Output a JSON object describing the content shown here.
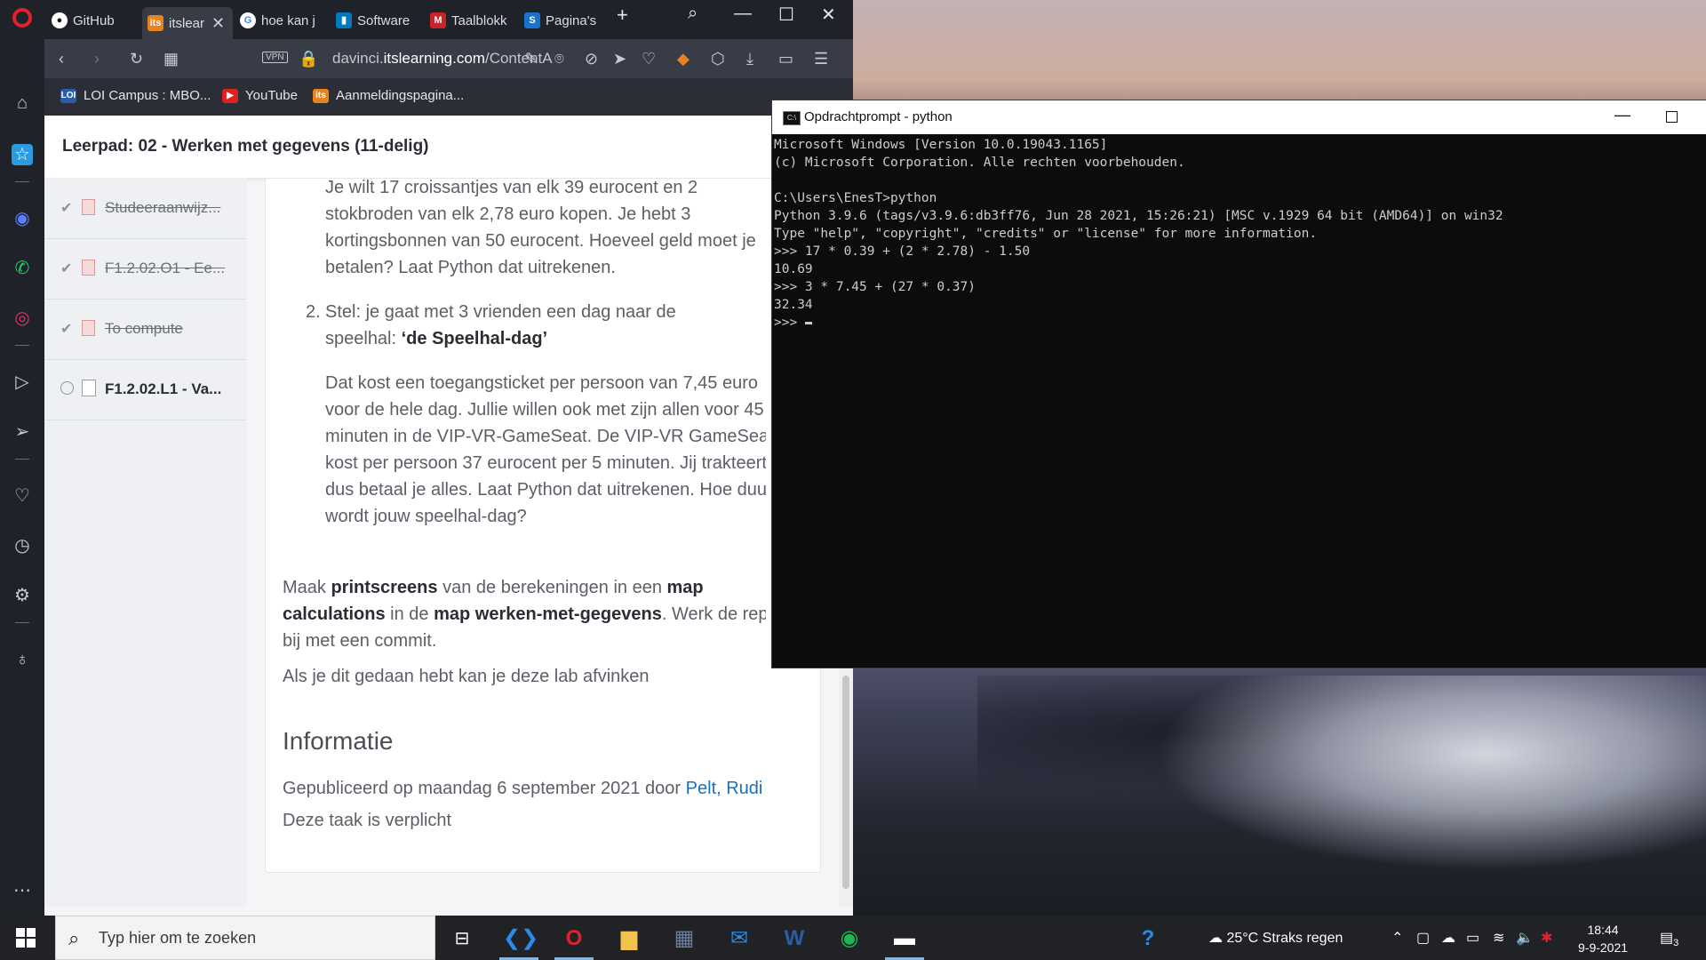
{
  "browser": {
    "tabs": [
      {
        "label": "GitHub",
        "icon": "github-icon"
      },
      {
        "label": "itslear",
        "icon": "itslearning-icon",
        "active": true
      },
      {
        "label": "hoe kan j",
        "icon": "google-icon"
      },
      {
        "label": "Software",
        "icon": "trello-icon"
      },
      {
        "label": "Taalblokk",
        "icon": "magazine-icon"
      },
      {
        "label": "Pagina's",
        "icon": "sharepoint-icon"
      }
    ],
    "url_prefix": "davinci.",
    "url_domain": "itslearning.com",
    "url_path": "/ContentA",
    "vpn_label": "VPN",
    "bookmarks": [
      {
        "label": "LOI Campus : MBO..."
      },
      {
        "label": "YouTube"
      },
      {
        "label": "Aanmeldingspagina..."
      }
    ]
  },
  "page": {
    "header_title": "Leerpad: 02 - Werken met gegevens (11-delig)",
    "nav_items": [
      {
        "label": "Studeeraanwijz...",
        "done": true
      },
      {
        "label": "F1.2.02.O1 - Ee...",
        "done": true
      },
      {
        "label": "To compute",
        "done": true
      },
      {
        "label": "F1.2.02.L1 - Va...",
        "done": false
      }
    ],
    "content": {
      "q1_line1": "Je wilt 17 croissantjes van elk 39 eurocent en 2",
      "q1_line2": "stokbroden van elk 2,78 euro kopen. Je hebt 3",
      "q1_line3": "kortingsbonnen van 50 eurocent. Hoeveel geld moet je",
      "q1_line4": "betalen? Laat Python dat uitrekenen.",
      "q2_number": "2.",
      "q2_line1": "Stel: je gaat met 3 vrienden een dag naar de",
      "q2_line2_prefix": "speelhal: ",
      "q2_line2_bold": "‘de Speelhal-dag’",
      "q2_p_line1": "Dat kost een toegangsticket per persoon van 7,45 euro",
      "q2_p_line2": "voor de hele dag. Jullie willen ook met zijn allen voor 45",
      "q2_p_line3": "minuten in de VIP-VR-GameSeat. De VIP-VR GameSeat",
      "q2_p_line4": "kost per persoon 37 eurocent per 5 minuten. Jij trakteert",
      "q2_p_line5": "dus betaal je alles. Laat Python dat uitrekenen. Hoe duur",
      "q2_p_line6": "wordt jouw speelhal-dag?",
      "maak_1a": "Maak ",
      "maak_1b": "printscreens",
      "maak_1c": " van de berekeningen in een ",
      "maak_1d": "map",
      "maak_2a": "calculations",
      "maak_2b": " in de ",
      "maak_2c": "map werken-met-gegevens",
      "maak_2d": ". Werk de repo",
      "maak_3": "bij met een commit.",
      "afvinken": "Als je dit gedaan hebt kan je deze lab afvinken",
      "info_heading": "Informatie",
      "published_prefix": "Gepubliceerd op maandag 6 september 2021 door ",
      "published_author": "Pelt, Rudi",
      "mandatory": "Deze taak is verplicht"
    }
  },
  "terminal": {
    "title": "Opdrachtprompt - python",
    "lines": [
      "Microsoft Windows [Version 10.0.19043.1165]",
      "(c) Microsoft Corporation. Alle rechten voorbehouden.",
      "",
      "C:\\Users\\EnesT>python",
      "Python 3.9.6 (tags/v3.9.6:db3ff76, Jun 28 2021, 15:26:21) [MSC v.1929 64 bit (AMD64)] on win32",
      "Type \"help\", \"copyright\", \"credits\" or \"license\" for more information.",
      ">>> 17 * 0.39 + (2 * 2.78) - 1.50",
      "10.69",
      ">>> 3 * 7.45 + (27 * 0.37)",
      "32.34"
    ],
    "prompt": ">>> "
  },
  "taskbar": {
    "search_placeholder": "Typ hier om te zoeken",
    "weather": "25°C  Straks regen",
    "time": "18:44",
    "date": "9-9-2021",
    "notifications": "3"
  }
}
